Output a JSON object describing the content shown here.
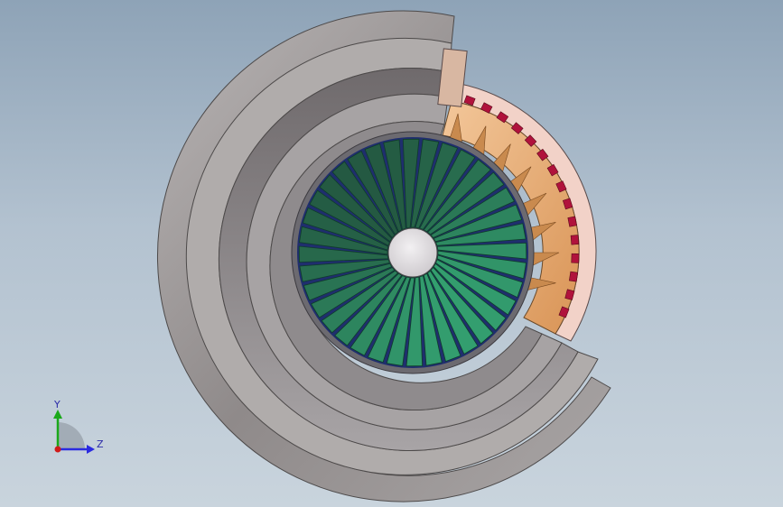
{
  "viewport": {
    "background_top": "#8ea3b7",
    "background_bottom": "#c9d4dd"
  },
  "model": {
    "fan_blade_color": "#1f8a5b",
    "casing_color": "#9a9696",
    "stator_color": "#e6a86a",
    "coil_color": "#b0123c",
    "blade_count": 36
  },
  "triad": {
    "y_label": "Y",
    "z_label": "Z",
    "y_color": "#1aa81a",
    "z_color": "#2a2ae0",
    "x_color": "#d01a1a"
  }
}
